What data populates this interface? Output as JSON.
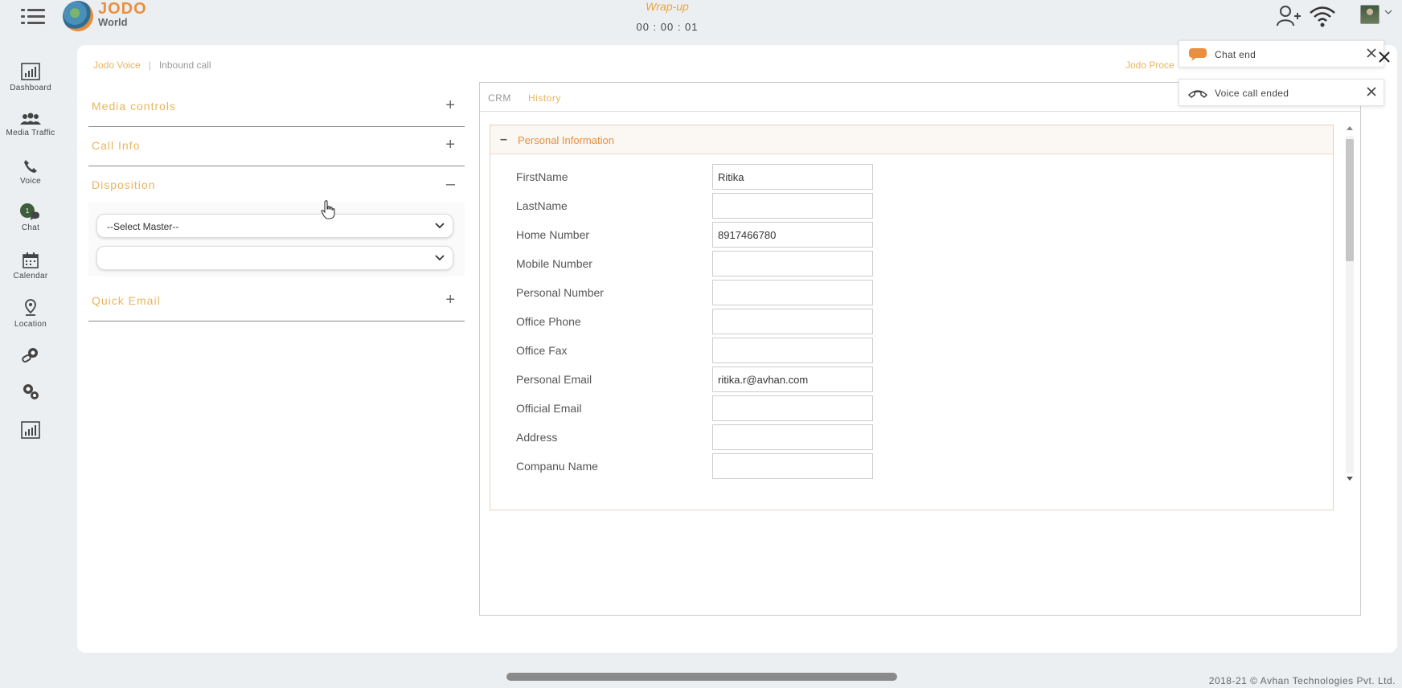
{
  "header": {
    "logo_line1": "JODO",
    "logo_line2": "World",
    "status": "Wrap-up",
    "timer": "00 : 00 : 01"
  },
  "sidebar": {
    "items": [
      {
        "label": "Dashboard",
        "icon": "dashboard-icon"
      },
      {
        "label": "Media Traffic",
        "icon": "users-icon"
      },
      {
        "label": "Voice",
        "icon": "phone-icon"
      },
      {
        "label": "Chat",
        "icon": "chat-icon",
        "badge": "1"
      },
      {
        "label": "Calendar",
        "icon": "calendar-icon"
      },
      {
        "label": "Location",
        "icon": "location-pin-icon"
      },
      {
        "label": "",
        "icon": "link-settings-icon"
      },
      {
        "label": "",
        "icon": "gears-icon"
      },
      {
        "label": "",
        "icon": "report-icon"
      }
    ]
  },
  "breadcrumb": {
    "root": "Jodo Voice",
    "separator": "|",
    "current": "Inbound call",
    "right": "Jodo Proce"
  },
  "accordion": [
    {
      "title": "Media controls",
      "sign": "+"
    },
    {
      "title": "Call Info",
      "sign": "+"
    },
    {
      "title": "Disposition",
      "sign": "–"
    },
    {
      "title": "Quick Email",
      "sign": "+"
    }
  ],
  "disposition": {
    "master_select": "--Select Master--",
    "sub_select": ""
  },
  "crm": {
    "tabs": [
      "CRM",
      "History"
    ],
    "section_sign": "–",
    "section_title": "Personal Information",
    "fields": [
      {
        "label": "FirstName",
        "value": "Ritika"
      },
      {
        "label": "LastName",
        "value": ""
      },
      {
        "label": "Home Number",
        "value": "8917466780"
      },
      {
        "label": "Mobile Number",
        "value": ""
      },
      {
        "label": "Personal Number",
        "value": ""
      },
      {
        "label": "Office Phone",
        "value": ""
      },
      {
        "label": "Office Fax",
        "value": ""
      },
      {
        "label": "Personal Email",
        "value": "ritika.r@avhan.com"
      },
      {
        "label": "Official Email",
        "value": ""
      },
      {
        "label": "Address",
        "value": ""
      },
      {
        "label": "Companu Name",
        "value": ""
      }
    ]
  },
  "notifications": [
    {
      "text": "Chat end",
      "icon": "chat-bubble-icon"
    },
    {
      "text": "Voice call ended",
      "icon": "hangup-icon"
    }
  ],
  "footer": {
    "copyright": "2018-21 © Avhan Technologies Pvt. Ltd."
  },
  "colors": {
    "accent": "#e8b55c",
    "accent_dark": "#e8903f",
    "background": "#eceff2"
  }
}
